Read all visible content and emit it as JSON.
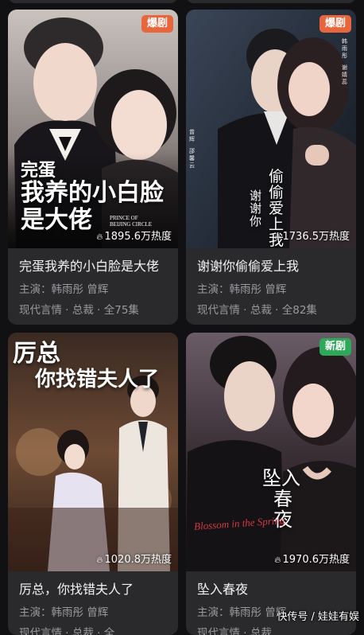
{
  "cards": [
    {
      "badge": "爆剧",
      "badge_color": "#e8663d",
      "overlay_lines": [
        "完蛋",
        "我养的小白脸",
        "是大佬"
      ],
      "overlay_en": "PRINCE OF BEIJING CIRCLE",
      "heat": "1895.6万热度",
      "title": "完蛋我养的小白脸是大佬",
      "cast": "主演：韩雨彤 曾辉",
      "tags": "现代言情 · 总裁 · 全75集"
    },
    {
      "badge": "爆剧",
      "badge_color": "#e8663d",
      "overlay_lines": [
        "偷偷爱上我",
        "谢谢你"
      ],
      "overlay_credits": [
        "曾辉",
        "邵馨云",
        "韩雨彤",
        "谢婧蕊"
      ],
      "heat": "1736.5万热度",
      "title": "谢谢你偷偷爱上我",
      "cast": "主演：韩雨彤 曾辉",
      "tags": "现代言情 · 总裁 · 全82集"
    },
    {
      "badge": "",
      "overlay_lines": [
        "厉总",
        "你找错夫人了"
      ],
      "heat": "1020.8万热度",
      "title": "厉总，你找错夫人了",
      "cast": "主演：韩雨彤 曾辉",
      "tags": "现代言情 · 总裁 · 全..."
    },
    {
      "badge": "新剧",
      "badge_color": "#2fa85a",
      "overlay_lines": [
        "坠入",
        "春夜"
      ],
      "overlay_en": "Blossom in the Spring",
      "heat": "1970.6万热度",
      "title": "坠入春夜",
      "cast": "主演：韩雨彤 曾辉",
      "tags": "现代言情 · 总裁"
    }
  ],
  "icons": {
    "heat": "flame-icon"
  },
  "watermark": "快传号 / 娃娃有娱"
}
